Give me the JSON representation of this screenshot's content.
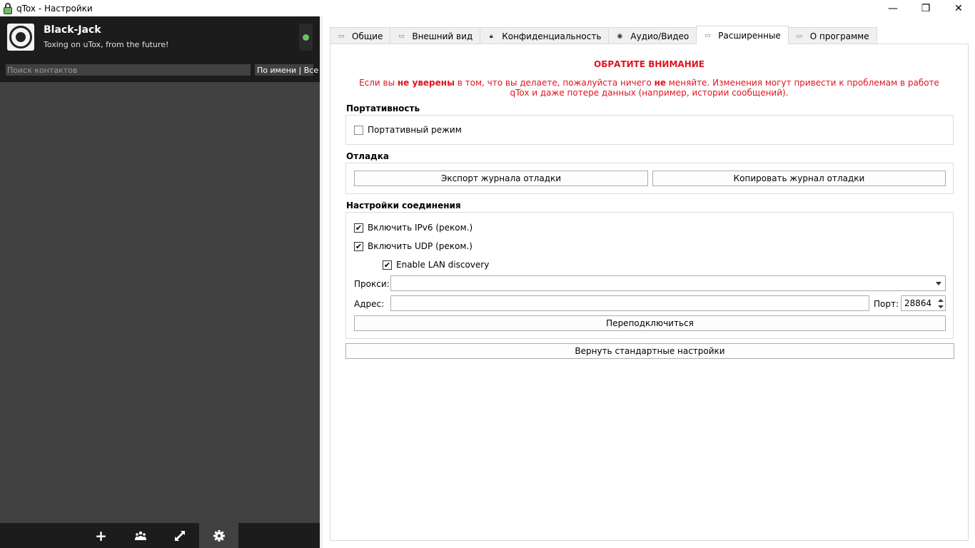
{
  "window": {
    "title": "qTox - Настройки",
    "minimize": "—",
    "restore": "❐",
    "close": "✕"
  },
  "profile": {
    "name": "Black-Jack",
    "status_message": "Toxing on uTox, from the future!",
    "status": "online",
    "status_color": "#6bc260"
  },
  "search": {
    "placeholder": "Поиск контактов",
    "filter_label": "По имени | Все"
  },
  "bottom_bar": {
    "add": "+",
    "groups": "groups-icon",
    "transfers": "transfers-icon",
    "settings": "gear-icon"
  },
  "tabs": [
    {
      "label": "Общие",
      "icon": "general-icon"
    },
    {
      "label": "Внешний вид",
      "icon": "appearance-icon"
    },
    {
      "label": "Конфиденциальность",
      "icon": "lock-icon"
    },
    {
      "label": "Аудио/Видео",
      "icon": "webcam-icon"
    },
    {
      "label": "Расширенные",
      "icon": "advanced-icon",
      "active": true
    },
    {
      "label": "О программе",
      "icon": "about-icon"
    }
  ],
  "warning": {
    "title": "ОБРАТИТЕ ВНИМАНИЕ",
    "text_1": "Если вы ",
    "text_bold_1": "не уверены",
    "text_2": " в том, что вы делаете, пожалуйста ничего ",
    "text_bold_2": "не",
    "text_3": " меняйте. Изменения могут привести к проблемам в работе qTox и даже потере данных (например, истории сообщений).",
    "color": "#e0141e"
  },
  "portability": {
    "title": "Портативность",
    "portable_mode_label": "Портативный режим",
    "portable_mode_checked": false
  },
  "debug": {
    "title": "Отладка",
    "export_log": "Экспорт журнала отладки",
    "copy_log": "Копировать журнал отладки"
  },
  "connection": {
    "title": "Настройки соединения",
    "ipv6_label": "Включить IPv6 (реком.)",
    "ipv6_checked": true,
    "udp_label": "Включить UDP (реком.)",
    "udp_checked": true,
    "lan_label": "Enable LAN discovery",
    "lan_checked": true,
    "proxy_label": "Прокси:",
    "proxy_value": "",
    "address_label": "Адрес:",
    "address_value": "",
    "port_label": "Порт:",
    "port_value": "28864",
    "reconnect": "Переподключиться"
  },
  "reset_defaults": "Вернуть стандартные настройки"
}
